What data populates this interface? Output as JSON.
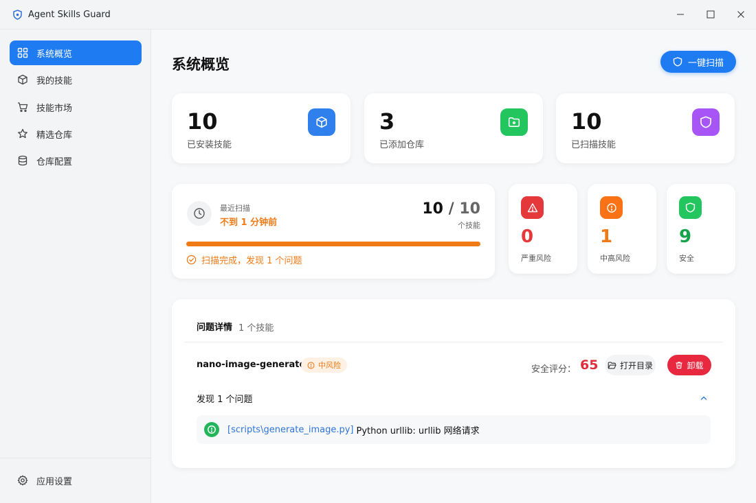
{
  "window": {
    "title": "Agent Skills Guard",
    "icons": {
      "logo": "shield-logo-icon",
      "minimize": "minimize-icon",
      "maximize": "maximize-icon",
      "close": "close-icon"
    }
  },
  "sidebar": {
    "items": [
      {
        "label": "系统概览",
        "icon": "dashboard-icon",
        "active": true
      },
      {
        "label": "我的技能",
        "icon": "package-icon"
      },
      {
        "label": "技能市场",
        "icon": "cart-icon"
      },
      {
        "label": "精选仓库",
        "icon": "star-icon"
      },
      {
        "label": "仓库配置",
        "icon": "database-icon"
      }
    ],
    "settings": {
      "label": "应用设置",
      "icon": "gear-icon"
    }
  },
  "main": {
    "title": "系统概览",
    "scan_button": "一键扫描",
    "stats": [
      {
        "value": "10",
        "label": "已安装技能",
        "icon": "package-icon",
        "color": "#2f80ed"
      },
      {
        "value": "3",
        "label": "已添加仓库",
        "icon": "folder-icon",
        "color": "#22c55e"
      },
      {
        "value": "10",
        "label": "已扫描技能",
        "icon": "shield-icon",
        "color": "#a855f7"
      }
    ],
    "scan": {
      "recent_label": "最近扫描",
      "recent_time": "不到 1 分钟前",
      "scanned": "10",
      "separator": "/",
      "total": "10",
      "unit": "个技能",
      "progress": 1.0,
      "status": "扫描完成，发现 1 个问题"
    },
    "risks": [
      {
        "value": "0",
        "label": "严重风险",
        "icon": "warning-triangle-icon",
        "color": "#e5383b",
        "text_color": "#e5383b"
      },
      {
        "value": "1",
        "label": "中高风险",
        "icon": "alert-circle-icon",
        "color": "#f97316",
        "text_color": "#f07a16"
      },
      {
        "value": "9",
        "label": "安全",
        "icon": "shield-icon",
        "color": "#22c55e",
        "text_color": "#16a34a"
      }
    ],
    "issues": {
      "title": "问题详情",
      "count": "1 个技能",
      "skill": {
        "name": "nano-image-generator",
        "risk_badge": "中风险",
        "score_label": "安全评分：",
        "score": "65",
        "open_dir": "打开目录",
        "uninstall": "卸载",
        "found": "发现 1 个问题",
        "items": [
          {
            "file": "[scripts\\generate_image.py]",
            "text": "Python urllib: urllib 网络请求"
          }
        ]
      }
    }
  }
}
